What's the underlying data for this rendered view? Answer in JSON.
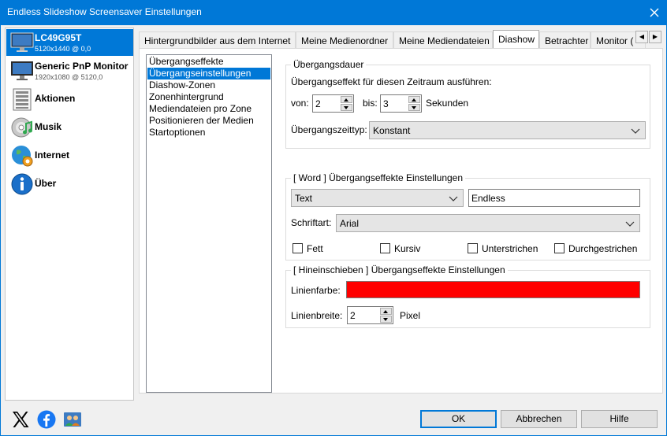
{
  "window": {
    "title": "Endless Slideshow Screensaver Einstellungen"
  },
  "sidebar": {
    "items": [
      {
        "name": "LC49G95T",
        "sub": "5120x1440 @ 0,0",
        "icon": "monitor-icon"
      },
      {
        "name": "Generic PnP Monitor",
        "sub": "1920x1080 @ 5120,0",
        "icon": "monitor-icon"
      },
      {
        "name": "Aktionen",
        "icon": "list-icon"
      },
      {
        "name": "Musik",
        "icon": "music-cd-icon"
      },
      {
        "name": "Internet",
        "icon": "globe-icon"
      },
      {
        "name": "Über",
        "icon": "info-icon"
      }
    ]
  },
  "tabs": [
    "Hintergrundbilder aus dem Internet",
    "Meine Medienordner",
    "Meine Mediendateien",
    "Diashow",
    "Betrachter",
    "Monitor ("
  ],
  "settings_list": [
    "Übergangseffekte",
    "Übergangseinstellungen",
    "Diashow-Zonen",
    "Zonenhintergrund",
    "Mediendateien pro Zone",
    "Positionieren der Medien",
    "Startoptionen"
  ],
  "duration": {
    "title": "Übergangsdauer",
    "desc": "Übergangseffekt für diesen Zeitraum ausführen:",
    "from_label": "von:",
    "from_value": "2",
    "to_label": "bis:",
    "to_value": "3",
    "unit": "Sekunden",
    "type_label": "Übergangszeittyp:",
    "type_value": "Konstant"
  },
  "word": {
    "title": "[ Word ] Übergangseffekte Einstellungen",
    "mode_value": "Text",
    "text_value": "Endless",
    "font_label": "Schriftart:",
    "font_value": "Arial",
    "bold": "Fett",
    "italic": "Kursiv",
    "underline": "Unterstrichen",
    "strike": "Durchgestrichen"
  },
  "slidein": {
    "title": "[ Hineinschieben ] Übergangseffekte Einstellungen",
    "color_label": "Linienfarbe:",
    "color": "#ff0000",
    "width_label": "Linienbreite:",
    "width_value": "2",
    "width_unit": "Pixel"
  },
  "buttons": {
    "ok": "OK",
    "cancel": "Abbrechen",
    "help": "Hilfe"
  },
  "social": [
    "x-icon",
    "facebook-icon",
    "users-icon"
  ],
  "colors": {
    "accent": "#0078d7",
    "selection": "#0078d7"
  }
}
